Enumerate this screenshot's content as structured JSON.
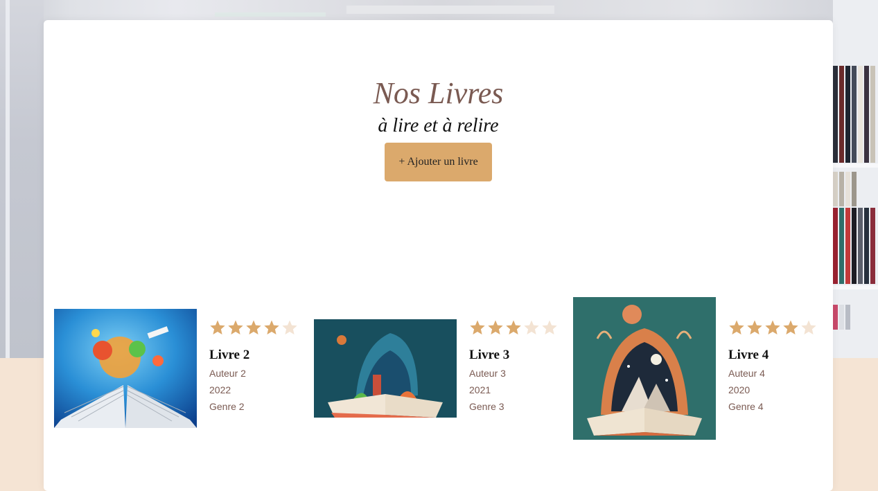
{
  "header": {
    "title": "Nos Livres",
    "subtitle": "à lire et à relire",
    "add_button_label": "+ Ajouter un livre"
  },
  "colors": {
    "accent": "#dba96c",
    "star_filled": "#dba96c",
    "star_empty": "#f3e3d3",
    "title": "#7a5a52",
    "page_bottom": "#f5e4d4"
  },
  "books": [
    {
      "title": "Livre 2",
      "author": "Auteur 2",
      "year": "2022",
      "genre": "Genre 2",
      "rating": 4,
      "rating_max": 5
    },
    {
      "title": "Livre 3",
      "author": "Auteur 3",
      "year": "2021",
      "genre": "Genre 3",
      "rating": 3,
      "rating_max": 5
    },
    {
      "title": "Livre 4",
      "author": "Auteur 4",
      "year": "2020",
      "genre": "Genre 4",
      "rating": 4,
      "rating_max": 5
    }
  ]
}
